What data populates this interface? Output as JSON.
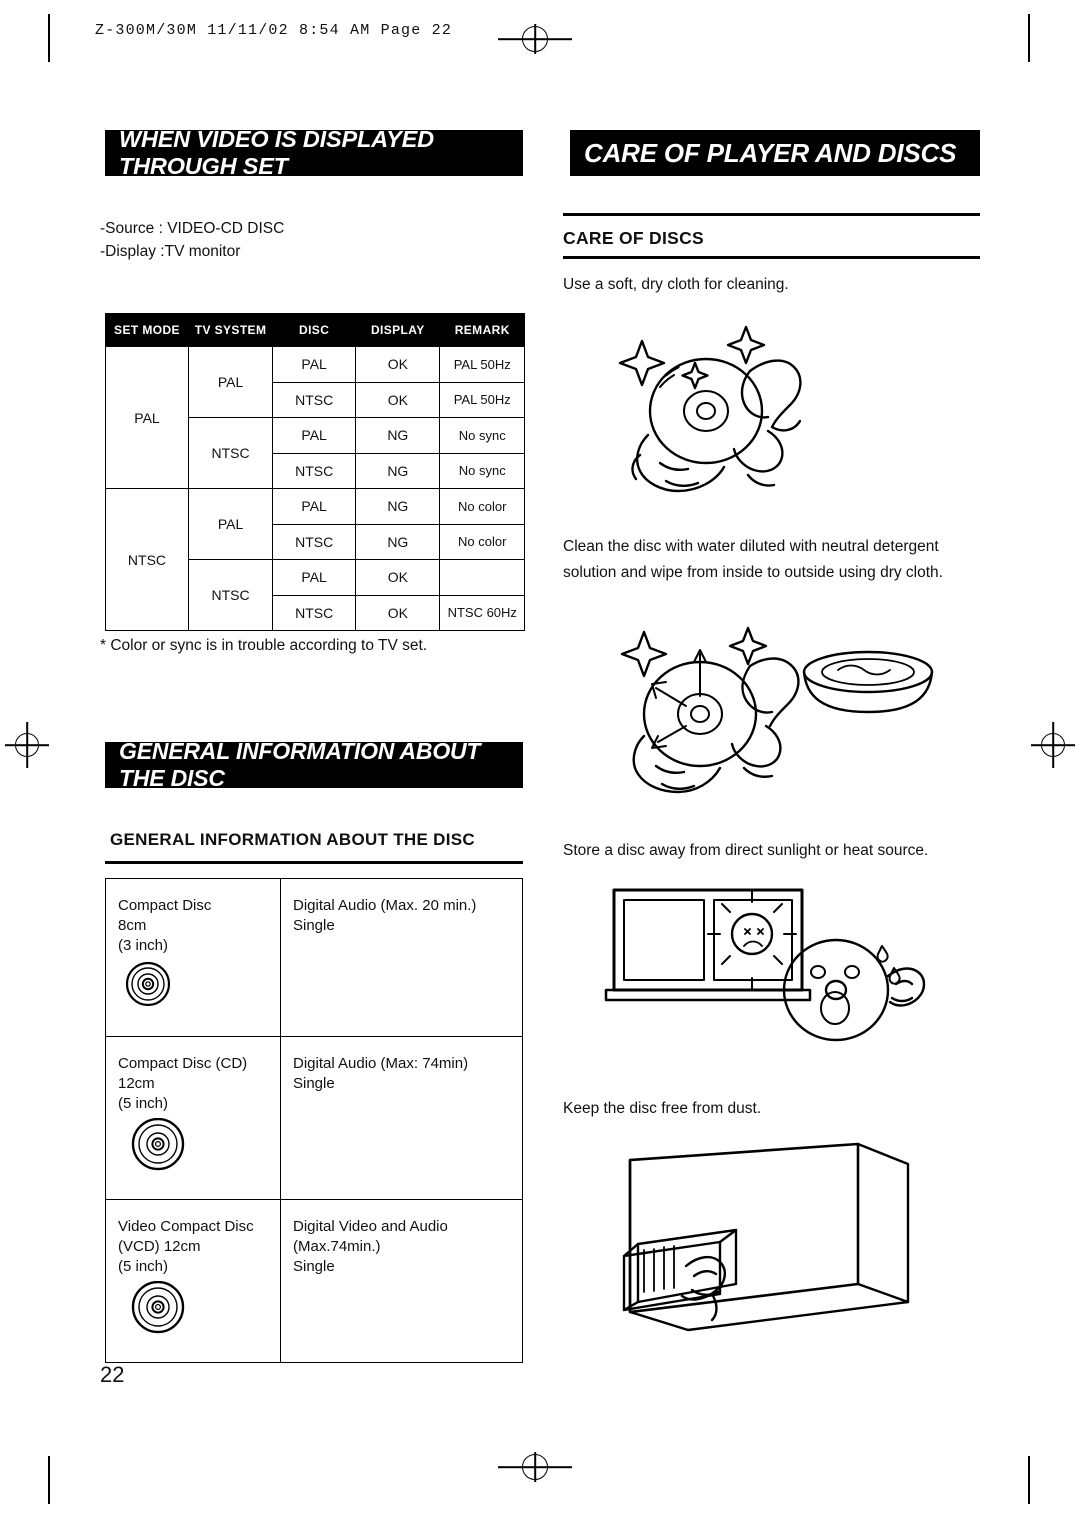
{
  "header": {
    "code_line": "Z-300M/30M  11/11/02 8:54 AM  Page 22"
  },
  "banners": {
    "video": "WHEN VIDEO IS DISPLAYED THROUGH SET",
    "care": "CARE OF PLAYER AND DISCS",
    "general": "GENERAL INFORMATION ABOUT THE DISC"
  },
  "left": {
    "source_line": "-Source : VIDEO-CD DISC",
    "display_line": "-Display :TV monitor",
    "note": "* Color or sync is in trouble according to TV set.",
    "general_heading": "GENERAL INFORMATION ABOUT THE DISC",
    "setmode_table": {
      "headers": [
        "SET MODE",
        "TV SYSTEM",
        "DISC",
        "DISPLAY",
        "REMARK"
      ],
      "rows": [
        {
          "set_mode": "PAL",
          "tv_system": "PAL",
          "disc": "PAL",
          "display": "OK",
          "remark": "PAL 50Hz"
        },
        {
          "set_mode": "",
          "tv_system": "",
          "disc": "NTSC",
          "display": "OK",
          "remark": "PAL 50Hz"
        },
        {
          "set_mode": "",
          "tv_system": "NTSC",
          "disc": "PAL",
          "display": "NG",
          "remark": "No sync"
        },
        {
          "set_mode": "",
          "tv_system": "",
          "disc": "NTSC",
          "display": "NG",
          "remark": "No sync"
        },
        {
          "set_mode": "NTSC",
          "tv_system": "PAL",
          "disc": "PAL",
          "display": "NG",
          "remark": "No color"
        },
        {
          "set_mode": "",
          "tv_system": "",
          "disc": "NTSC",
          "display": "NG",
          "remark": "No color"
        },
        {
          "set_mode": "",
          "tv_system": "NTSC",
          "disc": "PAL",
          "display": "OK",
          "remark": ""
        },
        {
          "set_mode": "",
          "tv_system": "",
          "disc": "NTSC",
          "display": "OK",
          "remark": "NTSC 60Hz"
        }
      ]
    },
    "disc_table": {
      "rows": [
        {
          "name": "Compact Disc",
          "size": "8cm",
          "inch": "(3 inch)",
          "content": "Digital Audio (Max. 20 min.)",
          "side": "Single"
        },
        {
          "name": "Compact Disc (CD)",
          "size": "12cm",
          "inch": "(5 inch)",
          "content": "Digital Audio (Max: 74min)",
          "side": "Single"
        },
        {
          "name": "Video Compact Disc",
          "size": "(VCD) 12cm",
          "inch": "(5 inch)",
          "content": "Digital Video and Audio (Max.74min.)",
          "side": "Single"
        }
      ]
    }
  },
  "right": {
    "care_heading": "CARE OF DISCS",
    "p1": "Use a soft, dry cloth for cleaning.",
    "p2": "Clean the disc with water diluted with neutral detergent solution and wipe from inside to outside using dry cloth.",
    "p3": "Store a disc away from direct sunlight or heat source.",
    "p4": "Keep the disc free from dust."
  },
  "footer": {
    "page_number": "22"
  }
}
